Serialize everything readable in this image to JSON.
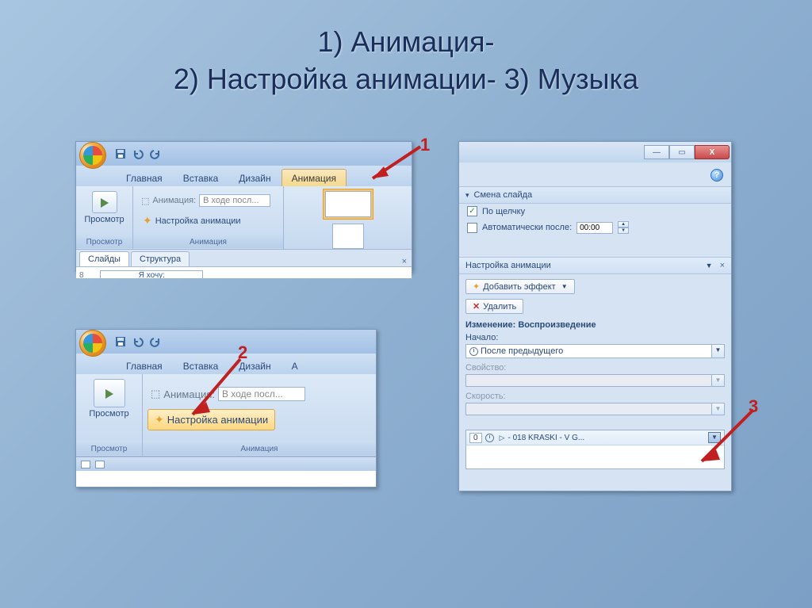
{
  "title_line1": "1) Анимация-",
  "title_line2": "2) Настройка анимации- 3) Музыка",
  "callouts": {
    "one": "1",
    "two": "2",
    "three": "3"
  },
  "ribbon": {
    "tabs": [
      "Главная",
      "Вставка",
      "Дизайн",
      "Анимация"
    ],
    "tabs_short": [
      "Главная",
      "Вставка",
      "Дизайн",
      "А"
    ],
    "preview_group": "Просмотр",
    "anim_group": "Анимация",
    "preview_btn": "Просмотр",
    "anim_label": "Анимация:",
    "anim_value": "В ходе посл...",
    "settings_btn": "Настройка анимации"
  },
  "doc_tabs": {
    "slides": "Слайды",
    "structure": "Структура",
    "num": "8",
    "thumb_text": "Я хочу:"
  },
  "right": {
    "win": {
      "min": "—",
      "max": "▭",
      "close": "X"
    },
    "help": "?",
    "transition_title": "Смена слайда",
    "on_click": "По щелчку",
    "auto_after": "Автоматически после:",
    "auto_value": "00:00",
    "pane_title": "Настройка анимации",
    "add_effect": "Добавить эффект",
    "delete": "Удалить",
    "change_label": "Изменение: Воспроизведение",
    "start_label": "Начало:",
    "start_value": "После предыдущего",
    "property_label": "Свойство:",
    "speed_label": "Скорость:",
    "effect": {
      "num": "0",
      "name": "- 018 KRASKI - V G..."
    }
  }
}
